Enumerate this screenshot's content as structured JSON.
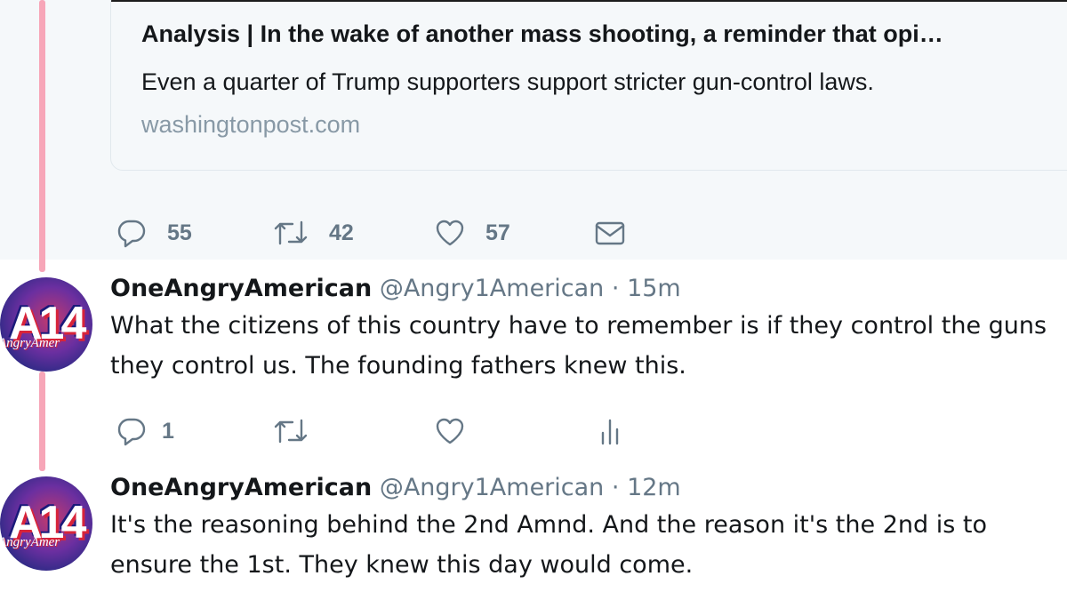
{
  "card": {
    "title": "Analysis | In the wake of another mass shooting, a reminder that opi…",
    "description": "Even a quarter of Trump supporters support stricter gun-control laws.",
    "domain": "washingtonpost.com"
  },
  "original_actions": {
    "replies": "55",
    "retweets": "42",
    "likes": "57"
  },
  "tweets": [
    {
      "name": "OneAngryAmerican",
      "handle": "@Angry1American",
      "separator": "·",
      "time": "15m",
      "text": "What the citizens of this country have to remember is if they control the guns they control us. The founding fathers knew this.",
      "avatar_text": "A14",
      "avatar_sub": "AngryAmer",
      "replies": "1"
    },
    {
      "name": "OneAngryAmerican",
      "handle": "@Angry1American",
      "separator": "·",
      "time": "12m",
      "text": "It's the reasoning behind the 2nd Amnd. And the reason it's the 2nd is to ensure the 1st. They knew this day would come.",
      "avatar_text": "A14",
      "avatar_sub": "AngryAmer"
    }
  ],
  "colors": {
    "thread_line": "#f7a6b8",
    "secondary_text": "#657786",
    "card_bg": "#f5f8fa"
  },
  "icons": [
    "reply-icon",
    "retweet-icon",
    "like-icon",
    "message-icon",
    "analytics-icon"
  ]
}
